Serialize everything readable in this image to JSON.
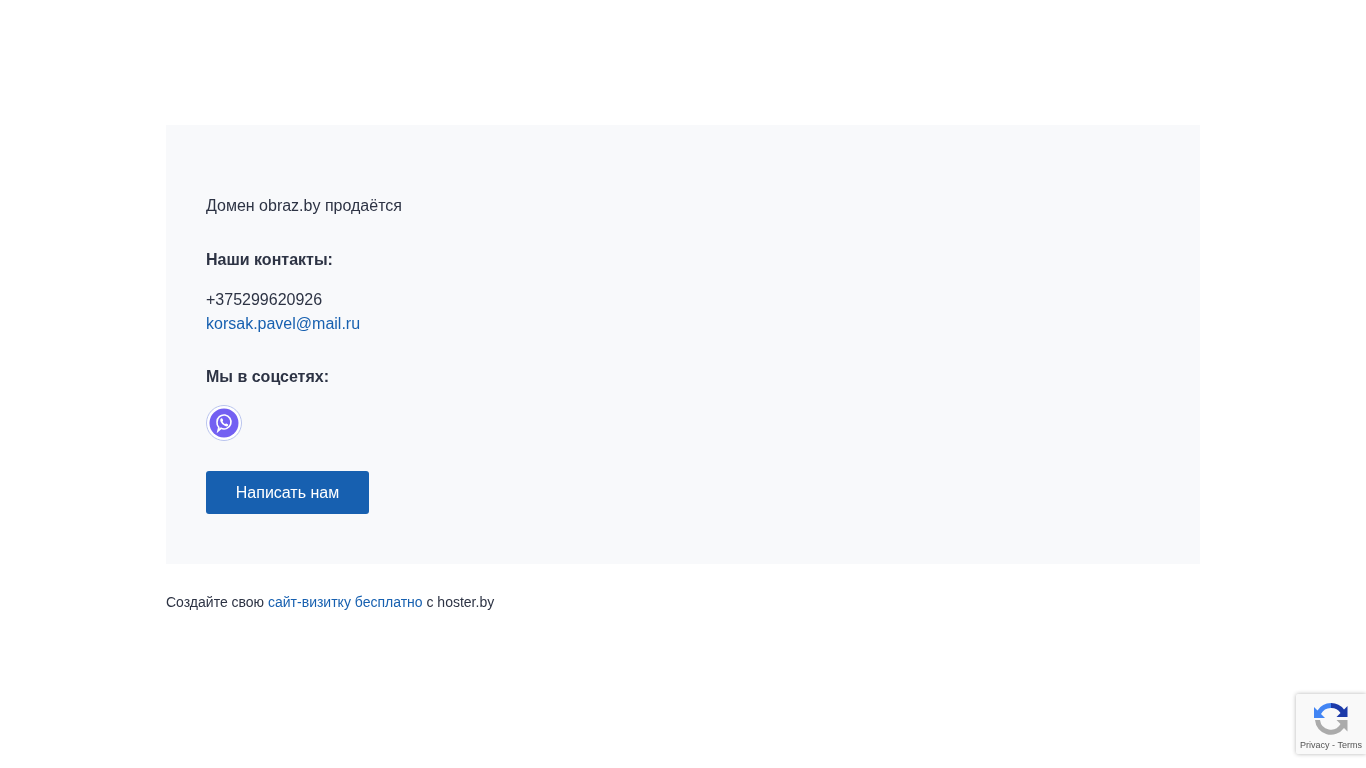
{
  "card": {
    "headline": "Домен obraz.by продаётся",
    "contacts_heading": "Наши контакты:",
    "phone": "+375299620926",
    "email": "korsak.pavel@mail.ru",
    "social_heading": "Мы в соцсетях:",
    "button": "Написать нам"
  },
  "footer": {
    "before": "Создайте свою",
    "link": "сайт-визитку бесплатно",
    "after": "с hoster.by"
  },
  "recaptcha": {
    "links": "Privacy - Terms"
  }
}
